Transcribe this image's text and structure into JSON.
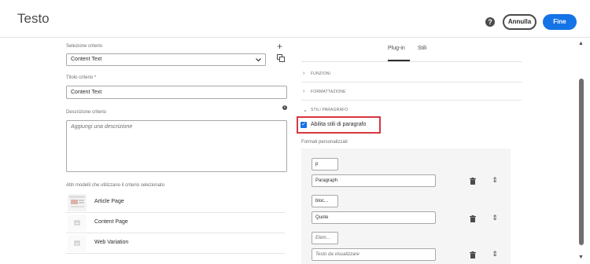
{
  "header": {
    "title": "Testo",
    "help_icon": "help-icon",
    "cancel_label": "Annulla",
    "done_label": "Fine"
  },
  "left": {
    "policy_select_label": "Selezione criterio",
    "policy_select_value": "Content Text",
    "policy_title_label": "Titolo criterio *",
    "policy_title_value": "Content Text",
    "policy_desc_label": "Descrizione criterio",
    "policy_desc_placeholder": "Aggiungi una descrizione",
    "templates_label": "Altri modelli che utilizzano il criterio selezionato",
    "templates": [
      {
        "name": "Article Page"
      },
      {
        "name": "Content Page"
      },
      {
        "name": "Web Variation"
      }
    ]
  },
  "right": {
    "tabs": [
      "Plug-in",
      "Stili"
    ],
    "active_tab": "Plug-in",
    "sections": [
      "FUNZIONI",
      "FORMATTAZIONE",
      "STILI PARAGRAFO"
    ],
    "enable_label": "Abilita stili di paragrafo",
    "enable_checked": true,
    "formats_label": "Formati personalizzati",
    "formats": [
      {
        "element": "p",
        "element_is_placeholder": false,
        "display": "Paragraph",
        "display_is_placeholder": false
      },
      {
        "element": "bloc...",
        "element_is_placeholder": false,
        "display": "Quote",
        "display_is_placeholder": false
      },
      {
        "element": "Elem...",
        "element_is_placeholder": true,
        "display": "Testo da visualizzare",
        "display_is_placeholder": true
      }
    ]
  },
  "colors": {
    "accent": "#1473e6",
    "highlight_border": "#d7373f"
  }
}
